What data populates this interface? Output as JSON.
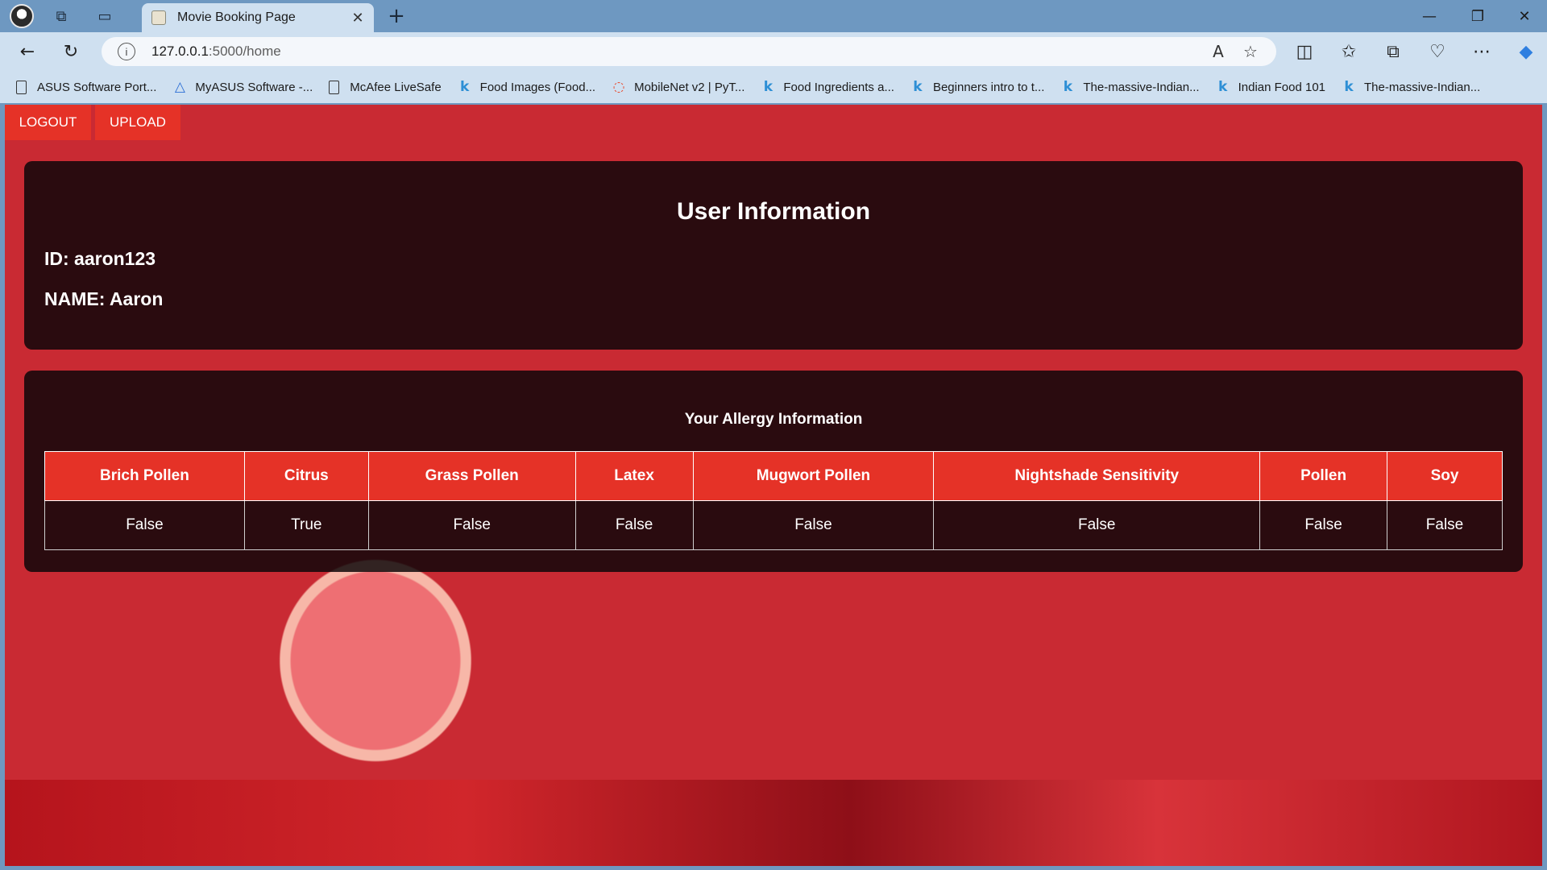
{
  "browser": {
    "tab_title": "Movie Booking Page",
    "url_host": "127.0.0.1",
    "url_path": ":5000/home",
    "bookmarks": [
      {
        "label": "ASUS Software Port...",
        "icon": "document-icon"
      },
      {
        "label": "MyASUS Software -...",
        "icon": "myasus-icon"
      },
      {
        "label": "McAfee LiveSafe",
        "icon": "document-icon"
      },
      {
        "label": "Food Images (Food...",
        "icon": "kaggle-icon"
      },
      {
        "label": "MobileNet v2 | PyT...",
        "icon": "pytorch-icon"
      },
      {
        "label": "Food Ingredients a...",
        "icon": "kaggle-icon"
      },
      {
        "label": "Beginners intro to t...",
        "icon": "kaggle-icon"
      },
      {
        "label": "The-massive-Indian...",
        "icon": "kaggle-icon"
      },
      {
        "label": "Indian Food 101",
        "icon": "kaggle-icon"
      },
      {
        "label": "The-massive-Indian...",
        "icon": "kaggle-icon"
      }
    ]
  },
  "page": {
    "logout_label": "LOGOUT",
    "upload_label": "UPLOAD",
    "user": {
      "title": "User Information",
      "id_line": "ID: aaron123",
      "name_line": "NAME: Aaron"
    },
    "allergy": {
      "title": "Your Allergy Information",
      "headers": [
        "Brich Pollen",
        "Citrus",
        "Grass Pollen",
        "Latex",
        "Mugwort Pollen",
        "Nightshade Sensitivity",
        "Pollen",
        "Soy"
      ],
      "values": [
        "False",
        "True",
        "False",
        "False",
        "False",
        "False",
        "False",
        "False"
      ]
    }
  },
  "colors": {
    "accent_red": "#e53227",
    "card_bg": "#0c0608",
    "chrome_bg": "#cfe0f0"
  }
}
